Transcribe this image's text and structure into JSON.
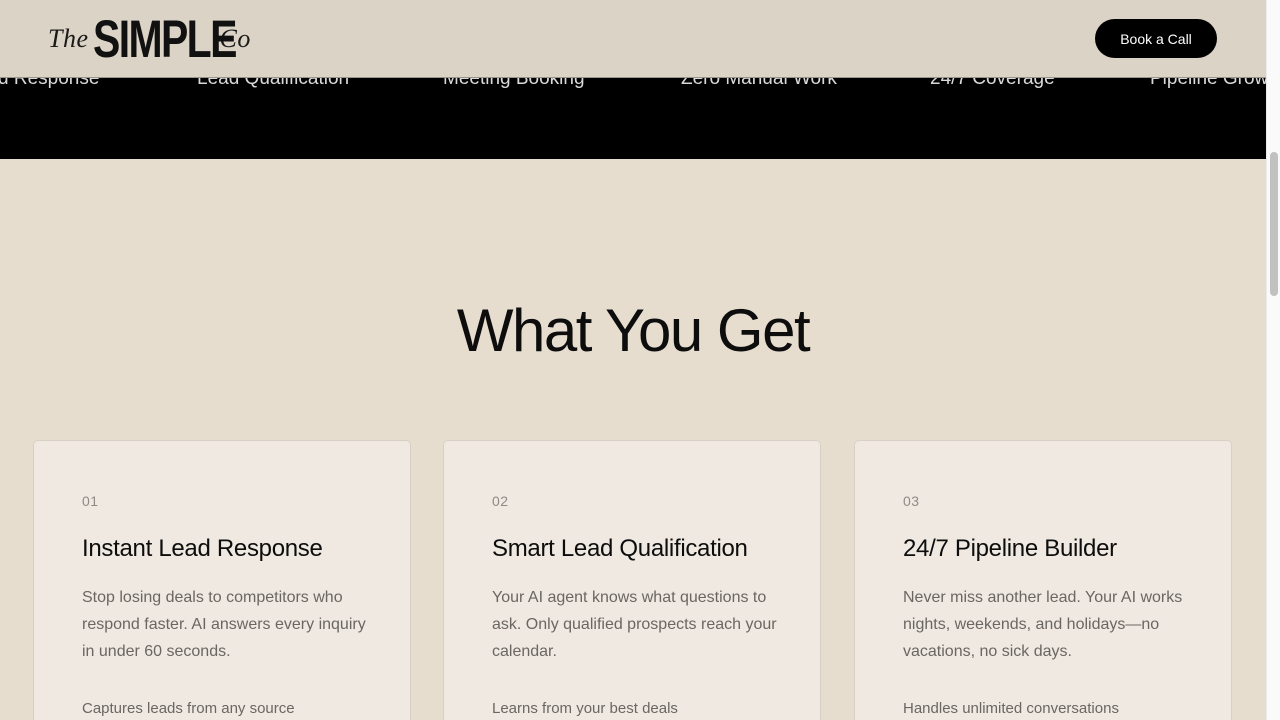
{
  "nav": {
    "logo": {
      "the": "The",
      "simple": "SIMPLE",
      "co": "Co"
    },
    "cta_label": "Book a Call"
  },
  "marquee": {
    "items": [
      "d Response",
      "Lead Qualification",
      "Meeting Booking",
      "Zero Manual Work",
      "24/7 Coverage",
      "Pipeline Grow"
    ]
  },
  "section": {
    "title": "What You Get"
  },
  "cards": [
    {
      "number": "01",
      "title": "Instant Lead Response",
      "description": "Stop losing deals to competitors who respond faster. AI answers every inquiry in under 60 seconds.",
      "feature": "Captures leads from any source"
    },
    {
      "number": "02",
      "title": "Smart Lead Qualification",
      "description": "Your AI agent knows what questions to ask. Only qualified prospects reach your calendar.",
      "feature": "Learns from your best deals"
    },
    {
      "number": "03",
      "title": "24/7 Pipeline Builder",
      "description": "Never miss another lead. Your AI works nights, weekends, and holidays—no vacations, no sick days.",
      "feature": "Handles unlimited conversations"
    }
  ]
}
